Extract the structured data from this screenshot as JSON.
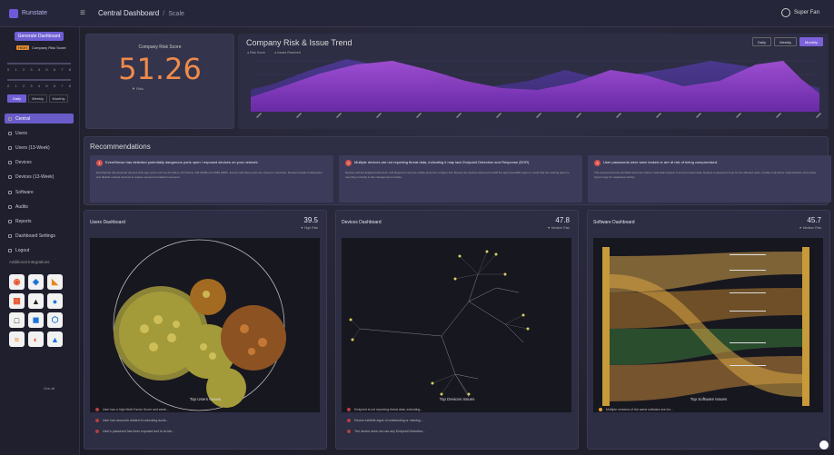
{
  "app": {
    "brand": "Runstate",
    "menu_icon": "hamburger-icon"
  },
  "header": {
    "breadcrumb_main": "Central Dashboard",
    "breadcrumb_sub": "Scale",
    "user": "Super Fan"
  },
  "sidebar": {
    "cta": "Generate Dashboard",
    "warn_tag": "HIGH",
    "warn_text": "Company Risk Score",
    "slider1_ticks": [
      "0",
      "1",
      "2",
      "3",
      "4",
      "5",
      "6",
      "7",
      "8"
    ],
    "slider2_ticks": [
      "0",
      "1",
      "2",
      "3",
      "4",
      "5",
      "6",
      "7",
      "8"
    ],
    "period": [
      "Daily",
      "Weekly",
      "Monthly"
    ],
    "period_active": "Daily",
    "nav": [
      {
        "label": "Central",
        "icon": "home-icon"
      },
      {
        "label": "Users",
        "icon": "users-icon"
      },
      {
        "label": "Users (13-Week)",
        "icon": "users-icon"
      },
      {
        "label": "Devices",
        "icon": "device-icon"
      },
      {
        "label": "Devices (13-Week)",
        "icon": "device-icon"
      },
      {
        "label": "Software",
        "icon": "software-icon"
      },
      {
        "label": "Audits",
        "icon": "audit-icon"
      },
      {
        "label": "Reports",
        "icon": "report-icon"
      },
      {
        "label": "Dashboard Settings",
        "icon": "settings-icon"
      },
      {
        "label": "Logout",
        "icon": "logout-icon"
      }
    ],
    "integrations_title": "Additional Integrations",
    "see_all": "See all"
  },
  "score": {
    "label": "Company Risk Score",
    "value": "51.26",
    "change": "▼ Risk"
  },
  "trend": {
    "title": "Company Risk & Issue Trend",
    "legend": [
      "Risk Score",
      "Issues Resolved"
    ],
    "buttons": [
      "Daily",
      "Weekly",
      "Monthly"
    ],
    "active": "Monthly"
  },
  "recs": {
    "title": "Recommendations",
    "items": [
      {
        "n": "1",
        "h": "EventSense has detected potentially dangerous ports open / exposed devices on your network.",
        "b": "EventSense has detected devices with open ports such as 22 (SSH), 23 (Telnet), 445 (SMB) and 3389 (RDP). Ensure that these ports are closed or restricted. Review firewall configuration and disable unused services to reduce exposure to lateral movement."
      },
      {
        "n": "2",
        "h": "Multiple devices are not reporting threat data, indicating it may lack Endpoint Detection and Response (EDR)",
        "b": "Devices without Endpoint Detection and Response are less visible and pose a higher risk. Review the devices listed and install the approved EDR agent or verify that the existing agent is reporting correctly to the management console."
      },
      {
        "n": "3",
        "h": "User passwords were seen leaked or are at risk of being compromised.",
        "b": "This assessment has identified accounts whose credentials appear in known breach data. Require a password reset for the affected users, enable multi-factor authentication and review sign-in logs for suspicious activity."
      }
    ]
  },
  "dashboards": [
    {
      "title": "Users Dashboard",
      "value": "39.5",
      "sub": "▼ High Risk",
      "issues_title": "Top Users Issues",
      "issues": [
        "User has a high Multi-Factor Score and weak...",
        "User has accounts related to unlocking accts...",
        "User's password has been exposed and is at risk..."
      ]
    },
    {
      "title": "Devices Dashboard",
      "value": "47.8",
      "sub": "▼ Medium Risk",
      "issues_title": "Top Devices Issues",
      "issues": [
        "Endpoint is not reporting threat data, indicating...",
        "Device exhibits signs of outstanding or missing...",
        "The device does not use any Endpoint Detection..."
      ]
    },
    {
      "title": "Software Dashboard",
      "value": "45.7",
      "sub": "▼ Medium Risk",
      "issues_title": "Top Software Issues",
      "issues": [
        "Multiple versions of the same software are ins..."
      ]
    }
  ],
  "chart_data": {
    "type": "area",
    "series": [
      {
        "name": "Risk Score"
      },
      {
        "name": "Issues Resolved"
      }
    ]
  }
}
